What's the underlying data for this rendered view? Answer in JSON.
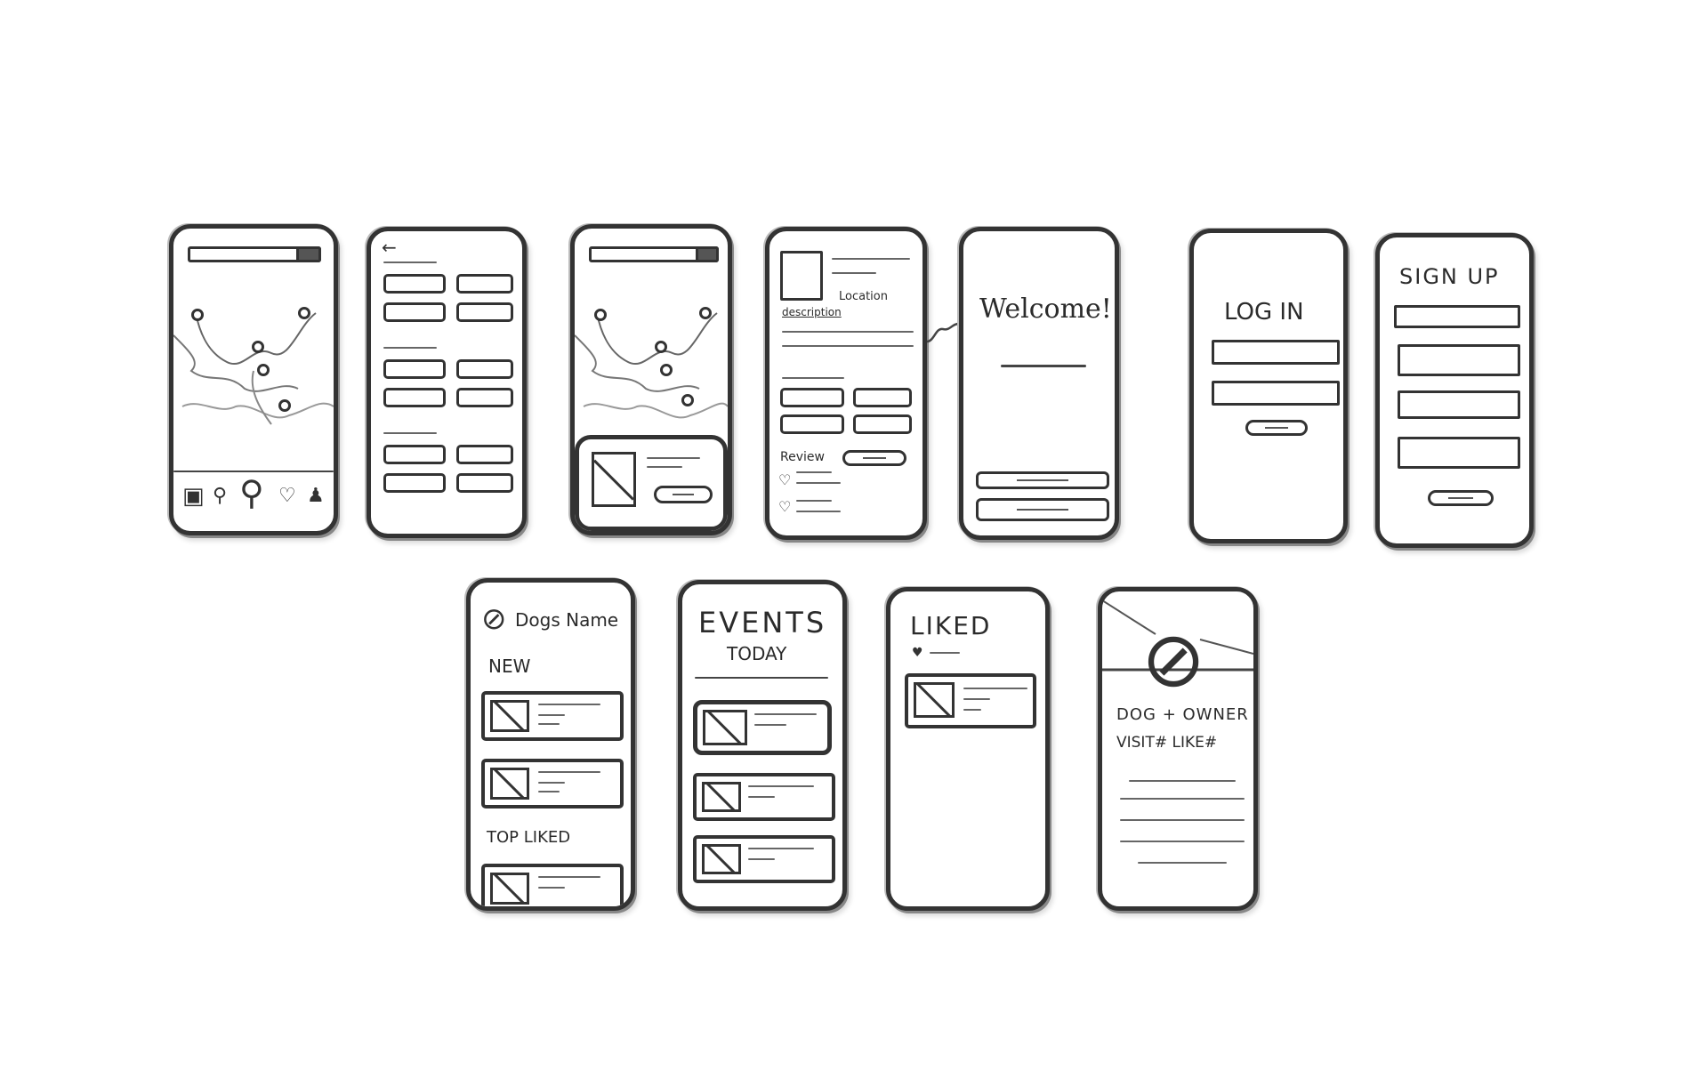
{
  "screens": {
    "map_main": {
      "nav_icons": [
        "bag-icon",
        "search-icon",
        "location-pin-icon",
        "heart-icon",
        "person-icon"
      ]
    },
    "location_detail": {
      "location_label": "Location",
      "description_label": "description",
      "review_label": "Review"
    },
    "welcome": {
      "title": "Welcome!"
    },
    "login": {
      "title": "LOG IN"
    },
    "signup": {
      "title": "SIGN UP"
    },
    "dog_profile": {
      "name": "Dogs Name",
      "section_new": "NEW",
      "section_top": "TOP LIKED"
    },
    "events": {
      "title": "EVENTS",
      "subtitle": "TODAY"
    },
    "liked": {
      "title": "LIKED"
    },
    "owner_profile": {
      "title": "DOG + OWNER",
      "stats": "VISIT# LIKE#"
    }
  },
  "colors": {
    "ink": "#333333",
    "paper": "#ffffff"
  }
}
